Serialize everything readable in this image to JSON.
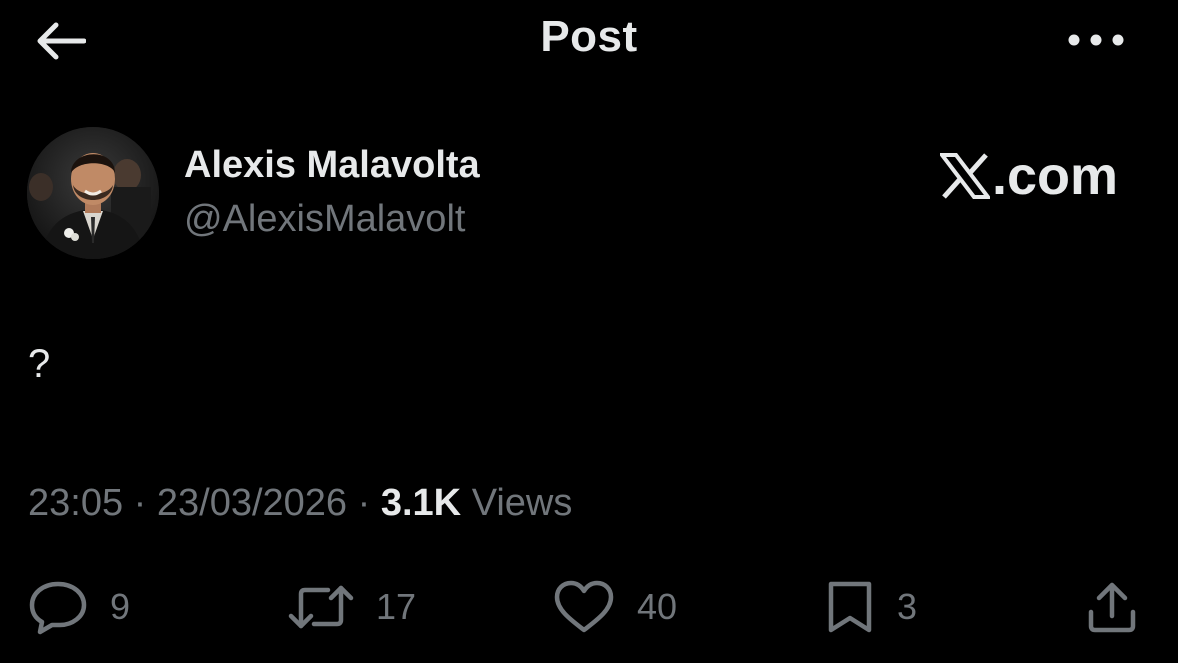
{
  "header": {
    "title": "Post",
    "back_icon": "arrow-left-icon",
    "more_icon": "more-horizontal-icon"
  },
  "author": {
    "display_name": "Alexis Malavolta",
    "handle": "@AlexisMalavolt",
    "avatar": "avatar-photo"
  },
  "brand": {
    "logo_text": ".com",
    "logo_icon": "x-logo-icon"
  },
  "post": {
    "text": "?"
  },
  "meta": {
    "time": "23:05",
    "separator": "·",
    "date": "23/03/2026",
    "views_count": "3.1K",
    "views_label": "Views"
  },
  "actions": {
    "reply": {
      "count": "9",
      "icon": "reply-icon"
    },
    "repost": {
      "count": "17",
      "icon": "repost-icon"
    },
    "like": {
      "count": "40",
      "icon": "heart-icon"
    },
    "bookmark": {
      "count": "3",
      "icon": "bookmark-icon"
    },
    "share": {
      "icon": "share-icon"
    }
  },
  "colors": {
    "background": "#000000",
    "primary_text": "#e7e9ea",
    "secondary_text": "#71767b"
  }
}
